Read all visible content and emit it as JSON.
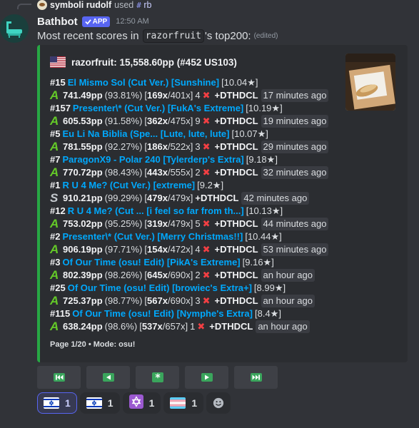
{
  "reply": {
    "username": "symboli rudolf",
    "used": "used",
    "command_prefix": "#",
    "command": "rb"
  },
  "message": {
    "author": "Bathbot",
    "app_tag": "APP",
    "timestamp": "12:50 AM",
    "text_before": "Most recent scores in",
    "code_user": "razorfruit",
    "text_after": "'s top200:",
    "edited": "(edited)"
  },
  "embed": {
    "accent_color": "#27a844",
    "author": "razorfruit: 15,558.60pp (#452 US103)",
    "footer": "Page 1/20 • Mode: osu!",
    "scores": [
      {
        "rank": "#15",
        "map": "El Mismo Sol (Cut Ver.) [Sunshine]",
        "stars": "[10.04★]",
        "grade": "A",
        "pp": "741.49pp",
        "acc": "(93.81%)",
        "combo": "169x",
        "max_combo": "/401x]",
        "misses": "4",
        "mods": "+DTHDCL",
        "ago": "17 minutes ago"
      },
      {
        "rank": "#157",
        "map": "Presenter\\* (Cut Ver.) [FukA's Extreme]",
        "stars": "[10.19★]",
        "grade": "A",
        "pp": "605.53pp",
        "acc": "(91.58%)",
        "combo": "362x",
        "max_combo": "/475x]",
        "misses": "9",
        "mods": "+DTHDCL",
        "ago": "19 minutes ago"
      },
      {
        "rank": "#5",
        "map": "Eu Li Na Biblia (Spe... [Lute, lute, lute]",
        "stars": "[10.07★]",
        "grade": "A",
        "pp": "781.55pp",
        "acc": "(92.27%)",
        "combo": "186x",
        "max_combo": "/522x]",
        "misses": "3",
        "mods": "+DTHDCL",
        "ago": "29 minutes ago"
      },
      {
        "rank": "#7",
        "map": "ParagonX9 - Polar 240 [Tylerderp's Extra]",
        "stars": "[9.18★]",
        "grade": "A",
        "pp": "770.72pp",
        "acc": "(98.43%)",
        "combo": "443x",
        "max_combo": "/555x]",
        "misses": "2",
        "mods": "+DTHDCL",
        "ago": "32 minutes ago"
      },
      {
        "rank": "#1",
        "map": "R U 4 Me? (Cut Ver.) [extreme]",
        "stars": "[9.2★]",
        "grade": "S",
        "pp": "910.21pp",
        "acc": "(99.29%)",
        "combo": "479x",
        "max_combo": "/479x]",
        "misses": "",
        "mods": "+DTHDCL",
        "ago": "42 minutes ago"
      },
      {
        "rank": "#12",
        "map": "R U 4 Me? (Cut ... [i feel so far from th...]",
        "stars": "[10.13★]",
        "grade": "A",
        "pp": "753.02pp",
        "acc": "(95.25%)",
        "combo": "319x",
        "max_combo": "/479x]",
        "misses": "5",
        "mods": "+DTHDCL",
        "ago": "44 minutes ago"
      },
      {
        "rank": "#2",
        "map": "Presenter\\* (Cut Ver.) [Merry Christmas!!]",
        "stars": "[10.44★]",
        "grade": "A",
        "pp": "906.19pp",
        "acc": "(97.71%)",
        "combo": "154x",
        "max_combo": "/472x]",
        "misses": "4",
        "mods": "+DTHDCL",
        "ago": "53 minutes ago"
      },
      {
        "rank": "#3",
        "map": "Of Our Time (osu! Edit) [PikA's Extreme]",
        "stars": "[9.16★]",
        "grade": "A",
        "pp": "802.39pp",
        "acc": "(98.26%)",
        "combo": "645x",
        "max_combo": "/690x]",
        "misses": "2",
        "mods": "+DTHDCL",
        "ago": "an hour ago"
      },
      {
        "rank": "#25",
        "map": "Of Our Time (osu! Edit) [browiec's Extra+]",
        "stars": "[8.99★]",
        "grade": "A",
        "pp": "725.37pp",
        "acc": "(98.77%)",
        "combo": "567x",
        "max_combo": "/690x]",
        "misses": "3",
        "mods": "+DTHDCL",
        "ago": "an hour ago"
      },
      {
        "rank": "#115",
        "map": "Of Our Time (osu! Edit) [Nymphe's Extra]",
        "stars": "[8.4★]",
        "grade": "A",
        "pp": "638.24pp",
        "acc": "(98.6%)",
        "combo": "537x",
        "max_combo": "/657x]",
        "misses": "1",
        "mods": "+DTHDCL",
        "ago": "an hour ago"
      }
    ]
  },
  "buttons": [
    {
      "name": "first-page-button",
      "icon": "skip-back-icon"
    },
    {
      "name": "previous-page-button",
      "icon": "play-left-icon"
    },
    {
      "name": "random-page-button",
      "icon": "asterisk-icon"
    },
    {
      "name": "next-page-button",
      "icon": "play-right-icon"
    },
    {
      "name": "last-page-button",
      "icon": "skip-forward-icon"
    }
  ],
  "reactions": [
    {
      "emoji": "israel-flag-icon",
      "count": "1",
      "me": true
    },
    {
      "emoji": "israel-flag-icon",
      "count": "1",
      "me": false
    },
    {
      "emoji": "star-of-david-icon",
      "count": "1",
      "me": false
    },
    {
      "emoji": "transgender-flag-icon",
      "count": "1",
      "me": false
    }
  ]
}
